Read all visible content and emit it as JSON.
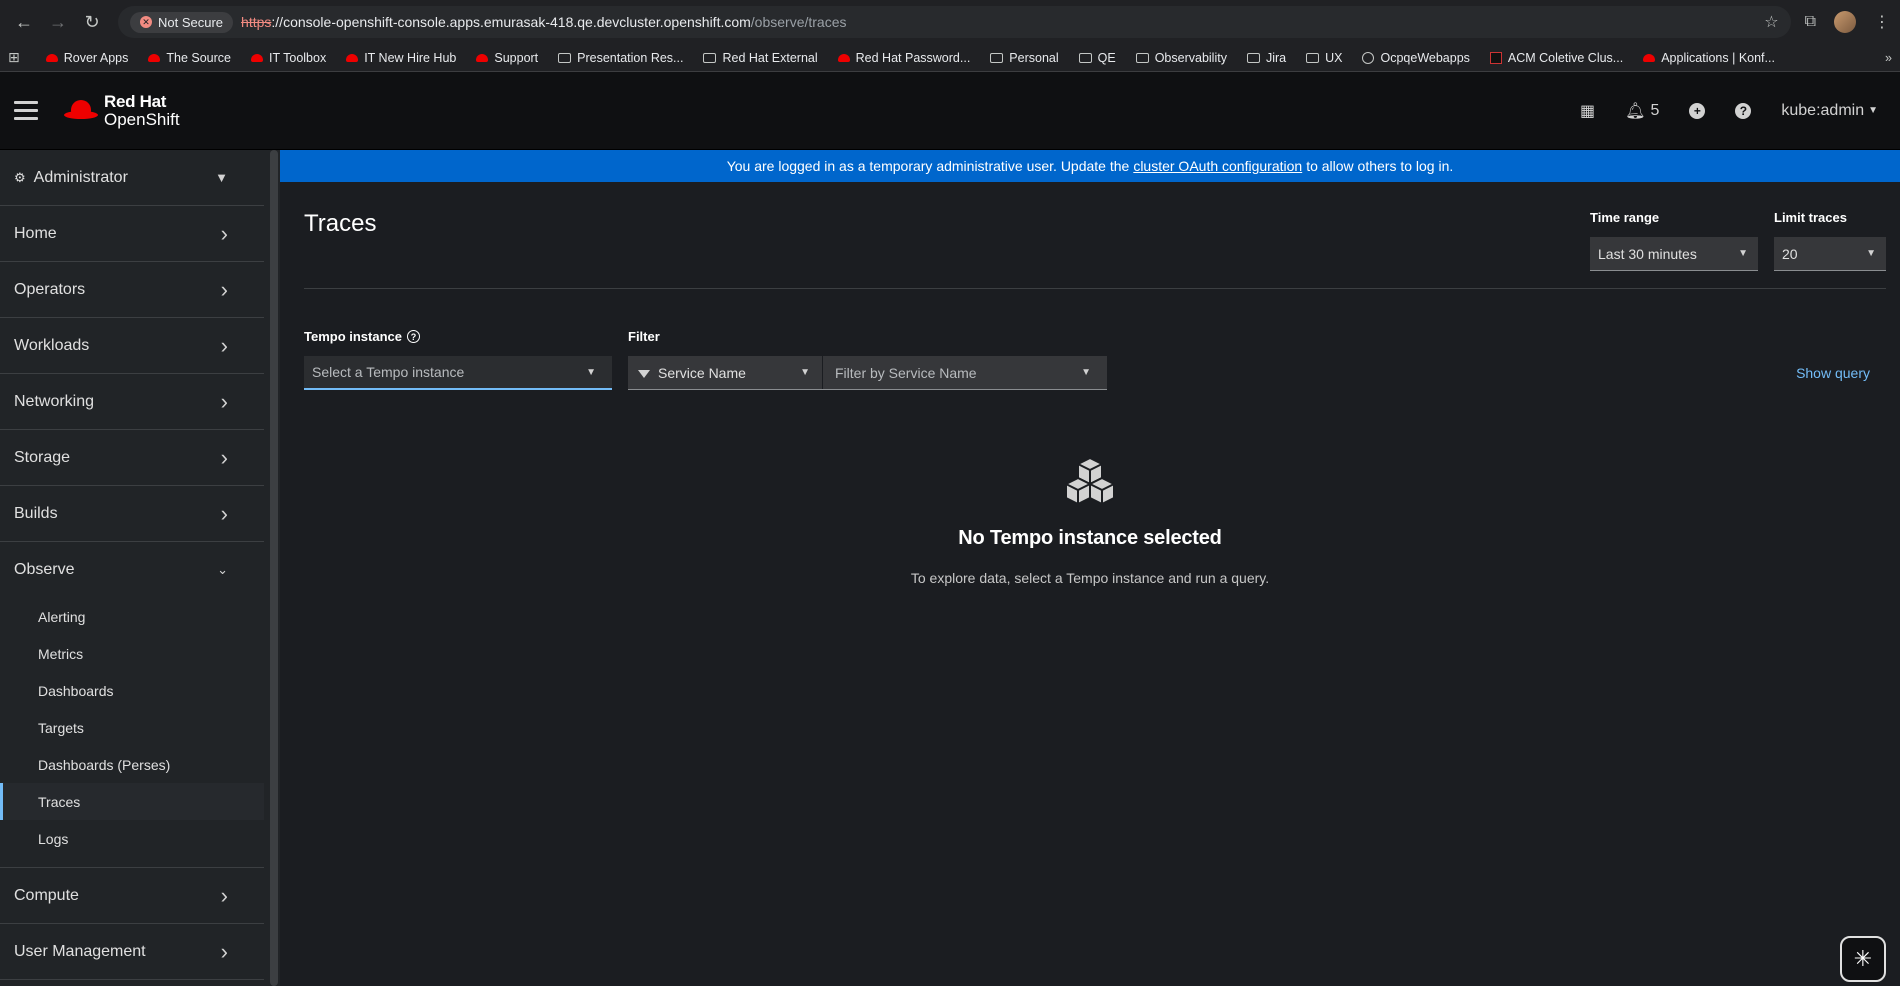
{
  "browser": {
    "not_secure": "Not Secure",
    "url_scheme": "https",
    "url_host": "://console-openshift-console.apps.emurasak-418.qe.devcluster.openshift.com",
    "url_path": "/observe/traces"
  },
  "bookmarks": [
    {
      "label": "Rover Apps",
      "icon": "redhat-icon"
    },
    {
      "label": "The Source",
      "icon": "redhat-icon"
    },
    {
      "label": "IT Toolbox",
      "icon": "redhat-icon"
    },
    {
      "label": "IT New Hire Hub",
      "icon": "redhat-icon"
    },
    {
      "label": "Support",
      "icon": "redhat-icon"
    },
    {
      "label": "Presentation Res...",
      "icon": "folder-icon"
    },
    {
      "label": "Red Hat External",
      "icon": "folder-icon"
    },
    {
      "label": "Red Hat Password...",
      "icon": "redhat-icon"
    },
    {
      "label": "Personal",
      "icon": "folder-icon"
    },
    {
      "label": "QE",
      "icon": "folder-icon"
    },
    {
      "label": "Observability",
      "icon": "folder-icon"
    },
    {
      "label": "Jira",
      "icon": "folder-icon"
    },
    {
      "label": "UX",
      "icon": "folder-icon"
    },
    {
      "label": "OcpqeWebapps",
      "icon": "globe-icon"
    },
    {
      "label": "ACM Coletive Clus...",
      "icon": "acm-icon"
    },
    {
      "label": "Applications | Konf...",
      "icon": "redhat-icon"
    }
  ],
  "masthead": {
    "brand_line1": "Red Hat",
    "brand_line2": "OpenShift",
    "notifications_count": "5",
    "user": "kube:admin"
  },
  "sidebar": {
    "perspective": "Administrator",
    "items": [
      {
        "label": "Home"
      },
      {
        "label": "Operators"
      },
      {
        "label": "Workloads"
      },
      {
        "label": "Networking"
      },
      {
        "label": "Storage"
      },
      {
        "label": "Builds"
      }
    ],
    "observe": {
      "label": "Observe",
      "children": [
        "Alerting",
        "Metrics",
        "Dashboards",
        "Targets",
        "Dashboards (Perses)",
        "Traces",
        "Logs"
      ],
      "active": "Traces"
    },
    "items_after": [
      {
        "label": "Compute"
      },
      {
        "label": "User Management"
      }
    ]
  },
  "banner": {
    "prefix": "You are logged in as a temporary administrative user. Update the",
    "link": "cluster OAuth configuration",
    "suffix": "to allow others to log in."
  },
  "page": {
    "title": "Traces",
    "time_range_label": "Time range",
    "time_range_value": "Last 30 minutes",
    "limit_label": "Limit traces",
    "limit_value": "20"
  },
  "filters": {
    "tempo_label": "Tempo instance",
    "tempo_placeholder": "Select a Tempo instance",
    "filter_label": "Filter",
    "filter_type": "Service Name",
    "filter_placeholder": "Filter by Service Name",
    "show_query": "Show query"
  },
  "empty_state": {
    "title": "No Tempo instance selected",
    "body": "To explore data, select a Tempo instance and run a query."
  }
}
